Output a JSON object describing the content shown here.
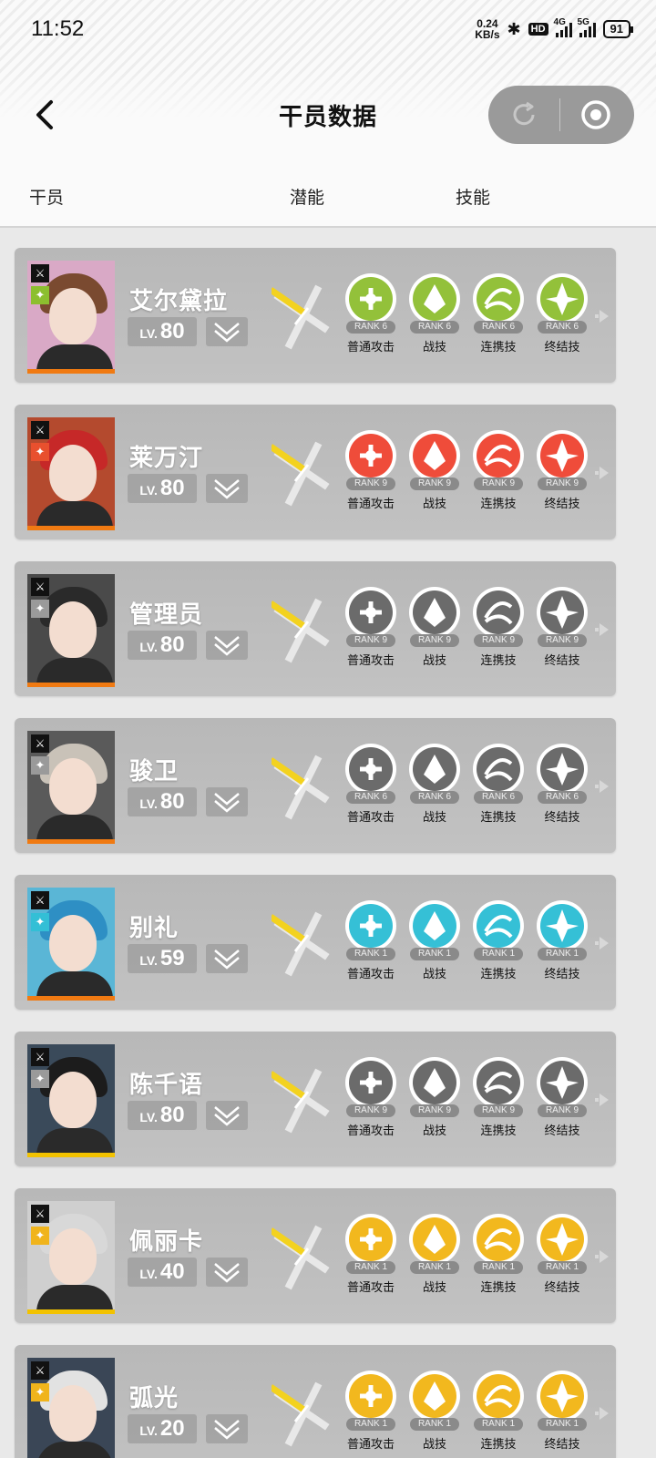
{
  "status": {
    "time": "11:52",
    "net_speed_value": "0.24",
    "net_speed_unit": "KB/s",
    "hd": "HD",
    "sig1": "4G",
    "sig2": "5G",
    "battery": "91"
  },
  "header": {
    "title": "干员数据",
    "col_operator": "干员",
    "col_potential": "潜能",
    "col_skill": "技能"
  },
  "skill_names": [
    "普通攻击",
    "战技",
    "连携技",
    "终结技"
  ],
  "operators": [
    {
      "name": "艾尔黛拉",
      "lv_label": "LV.",
      "level": "80",
      "rank": "RANK 6",
      "element_color": "#8cbf2f",
      "element_icon": "leaf-icon",
      "class_icon": "guard-icon",
      "hair_color": "#7a4a30",
      "skill_color": "#93c13a",
      "portrait_bg": "#d9a9c6"
    },
    {
      "name": "莱万汀",
      "lv_label": "LV.",
      "level": "80",
      "rank": "RANK 9",
      "element_color": "#e8502e",
      "element_icon": "flame-icon",
      "class_icon": "striker-icon",
      "hair_color": "#c62828",
      "skill_color": "#ef4c3a",
      "portrait_bg": "#b44a2e"
    },
    {
      "name": "管理员",
      "lv_label": "LV.",
      "level": "80",
      "rank": "RANK 9",
      "element_color": "#9a9a9a",
      "element_icon": "physical-icon",
      "class_icon": "guard-icon",
      "hair_color": "#2a2a2a",
      "skill_color": "#6b6b6b",
      "portrait_bg": "#4a4a4a"
    },
    {
      "name": "骏卫",
      "lv_label": "LV.",
      "level": "80",
      "rank": "RANK 6",
      "element_color": "#9a9a9a",
      "element_icon": "physical-icon",
      "class_icon": "vanguard-icon",
      "hair_color": "#c9c2b8",
      "skill_color": "#6b6b6b",
      "portrait_bg": "#5a5a5a"
    },
    {
      "name": "别礼",
      "lv_label": "LV.",
      "level": "59",
      "rank": "RANK 1",
      "element_color": "#33bfd6",
      "element_icon": "ice-icon",
      "class_icon": "striker-icon",
      "hair_color": "#2e8fc4",
      "skill_color": "#35c0d6",
      "portrait_bg": "#5ab6d6"
    },
    {
      "name": "陈千语",
      "lv_label": "LV.",
      "level": "80",
      "rank": "RANK 9",
      "element_color": "#9a9a9a",
      "element_icon": "physical-icon",
      "class_icon": "guard-icon",
      "hair_color": "#1c1c1c",
      "skill_color": "#6b6b6b",
      "portrait_bg": "#3a4a5a"
    },
    {
      "name": "佩丽卡",
      "lv_label": "LV.",
      "level": "40",
      "rank": "RANK 1",
      "element_color": "#f0b41c",
      "element_icon": "electric-icon",
      "class_icon": "caster-icon",
      "hair_color": "#d8d8d8",
      "skill_color": "#f2b81e",
      "portrait_bg": "#cfcfcf"
    },
    {
      "name": "弧光",
      "lv_label": "LV.",
      "level": "20",
      "rank": "RANK 1",
      "element_color": "#f0b41c",
      "element_icon": "electric-icon",
      "class_icon": "vanguard-icon",
      "hair_color": "#e2e2e2",
      "skill_color": "#f2b81e",
      "portrait_bg": "#3a4656"
    }
  ]
}
